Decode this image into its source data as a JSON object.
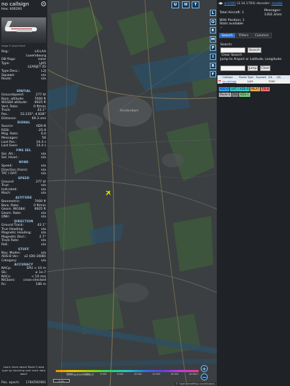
{
  "panel": {
    "callsign": "no callsign",
    "hex_label": "Hex: 400293",
    "photo_credit": "Image © Jesse Eckert",
    "basic": [
      {
        "k": "Reg.:",
        "v": "LX-LAA"
      },
      {
        "k": "",
        "v": "Luxembourg"
      },
      {
        "k": "DB flags:",
        "v": "none"
      },
      {
        "k": "Type:",
        "v": "LJ45"
      },
      {
        "k": "",
        "v": "LEARJET 45"
      },
      {
        "k": "Type Desc.:",
        "v": "L2J"
      },
      {
        "k": "Squawk:",
        "v": "n/a"
      },
      {
        "k": "Route:",
        "v": "n/a"
      }
    ],
    "sections": [
      {
        "title": "SPATIAL",
        "rows": [
          {
            "k": "Groundspeed:",
            "v": "277 kt"
          },
          {
            "k": "Baro. altitude:",
            "v": "7000 ft"
          },
          {
            "k": "WGS84 altitude:",
            "v": "6925 ft"
          },
          {
            "k": "Vert. Rate:",
            "v": "0 ft/min"
          },
          {
            "k": "Track:",
            "v": "43.1°"
          },
          {
            "k": "Pos.:",
            "v": "52.235°, 4.828°"
          },
          {
            "k": "Distance:",
            "v": "69.3 nmi"
          }
        ]
      },
      {
        "title": "SIGNAL",
        "rows": [
          {
            "k": "Source:",
            "v": "ADS-B"
          },
          {
            "k": "RSSI:",
            "v": "-25.9"
          },
          {
            "k": "Msg. Rate:",
            "v": "0.0"
          },
          {
            "k": "Messages:",
            "v": "56"
          },
          {
            "k": "Last Pos.:",
            "v": "14.4 s"
          },
          {
            "k": "Last Seen:",
            "v": "14.4 s"
          }
        ]
      },
      {
        "title": "FMS SEL",
        "rows": [
          {
            "k": "Sel. Alt.:",
            "v": "n/a"
          },
          {
            "k": "Sel. Head.:",
            "v": "n/a"
          }
        ]
      },
      {
        "title": "WIND",
        "rows": [
          {
            "k": "Speed:",
            "v": "n/a"
          },
          {
            "k": "Direction (from):",
            "v": "n/a"
          },
          {
            "k": "TAT / OAT:",
            "v": "n/a"
          }
        ]
      },
      {
        "title": "SPEED",
        "rows": [
          {
            "k": "Ground:",
            "v": "277 kt"
          },
          {
            "k": "True:",
            "v": "n/a"
          },
          {
            "k": "Indicated:",
            "v": "n/a"
          },
          {
            "k": "Mach:",
            "v": "n/a"
          }
        ]
      },
      {
        "title": "ALTITUDE",
        "rows": [
          {
            "k": "Barometric:",
            "v": "7000 ft"
          },
          {
            "k": "Baro. Rate:",
            "v": "0 ft/min"
          },
          {
            "k": "Geom. WGS84:",
            "v": "6925 ft"
          },
          {
            "k": "Geom. Rate:",
            "v": "n/a"
          },
          {
            "k": "QNH:",
            "v": "n/a"
          }
        ]
      },
      {
        "title": "DIRECTION",
        "rows": [
          {
            "k": "Ground Track:",
            "v": "43.1°"
          },
          {
            "k": "True Heading:",
            "v": "n/a"
          },
          {
            "k": "Magnetic Heading:",
            "v": "n/a"
          },
          {
            "k": "Magnetic Decl.:",
            "v": "2.7°"
          },
          {
            "k": "Track Rate:",
            "v": "n/a"
          },
          {
            "k": "Roll:",
            "v": "n/a"
          }
        ]
      },
      {
        "title": "STUFF",
        "rows": [
          {
            "k": "Nav. Modes:",
            "v": "n/a"
          },
          {
            "k": "ADS-B Ver.:",
            "v": "v2 (DO-260B)"
          },
          {
            "k": "Category:",
            "v": "n/a"
          }
        ]
      },
      {
        "title": "ACCURACY",
        "rows": [
          {
            "k": "NACp:",
            "v": "EPU < 10 m"
          },
          {
            "k": "SIL:",
            "v": "≤ 1e-7"
          },
          {
            "k": "NACv:",
            "v": "< 10 m/s"
          },
          {
            "k": "NICbaro:",
            "v": "cross-checked"
          },
          {
            "k": "Rc:",
            "v": "186 m"
          }
        ]
      }
    ],
    "learn_more": "Learn more about Mode S data type by hovering over each data label!",
    "epoch_label": "Pos. epoch:",
    "epoch_value": "1784592981"
  },
  "map": {
    "top_buttons": [
      "U",
      "H",
      "T"
    ],
    "side_buttons": [
      "L",
      "O",
      "K",
      "M",
      "P",
      "I",
      "R",
      "F"
    ],
    "cities": [
      {
        "name": "Amsterdam"
      },
      {
        "name": "Krimpenerwaard"
      }
    ],
    "zoom_in": "+",
    "zoom_out": "−",
    "colorbar_labels": [
      "",
      "2 000",
      "4 000",
      "6 000",
      "8 000",
      "10 000",
      "20 000",
      "30 000",
      "40 000+"
    ],
    "scale_label": "5 nm",
    "attribution": "© OpenStreetMap contributors."
  },
  "right": {
    "link": "ar1090",
    "version": "(3.14.1793)",
    "decoder_label": "decoder:",
    "decoder_value": "readsb",
    "total_label": "Total Aircraft: 1",
    "messages_label": "Messages:",
    "messages_value": "1302.3/sec",
    "with_position": "With Position: 1",
    "stats_available": "Stats available",
    "tabs": [
      "Search",
      "Filters",
      "Columns"
    ],
    "search_label": "Search:",
    "search_button": "Search",
    "clear_search_button": "Clear Search",
    "jump_label": "Jump to Airport or Latitude, Longitude:",
    "jump_button": "Jump",
    "clear_button": "Clear",
    "table_headers": [
      "",
      "Callsign",
      "Route",
      "Type",
      "Squawk",
      "Alt.",
      "(ft)"
    ],
    "table_rows": [
      [
        "",
        "no callsign",
        "",
        "LJ45",
        "",
        "7000"
      ]
    ],
    "legend": [
      {
        "label": "ADS-B",
        "color": "#3ca0ff"
      },
      {
        "label": "UAT / ADS-R",
        "color": "#3ac8c8"
      },
      {
        "label": "MLAT",
        "color": "#e8b050"
      },
      {
        "label": "TIS-B",
        "color": "#f07070"
      },
      {
        "label": "Mode-S",
        "color": "#bbbbbb"
      },
      {
        "label": "AIS",
        "color": "#888888"
      },
      {
        "label": "ADS-C",
        "color": "#7ad07a"
      }
    ]
  }
}
